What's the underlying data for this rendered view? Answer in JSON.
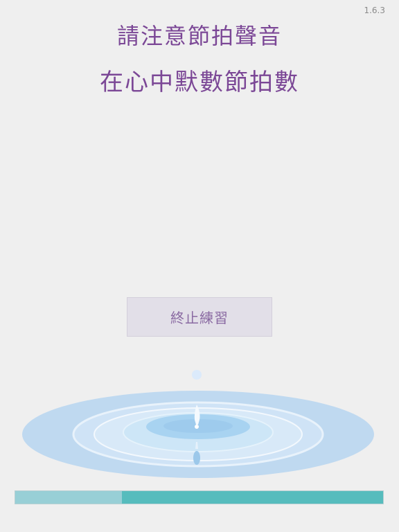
{
  "app": {
    "version": "1.6.3"
  },
  "instructions": {
    "line1": "請注意節拍聲音",
    "line2": "在心中默數節拍數"
  },
  "actions": {
    "stop_label": "終止練習"
  },
  "progress": {
    "value": 0.29
  },
  "colors": {
    "text_purple": "#7b4796",
    "button_bg": "#e2dfe8",
    "button_text": "#8a6aa2",
    "progress_track": "#56bcbd",
    "progress_fill": "#98cfd6",
    "water": "#bfd9f0"
  },
  "illustration": {
    "icon": "water-drop-ripple-icon"
  }
}
